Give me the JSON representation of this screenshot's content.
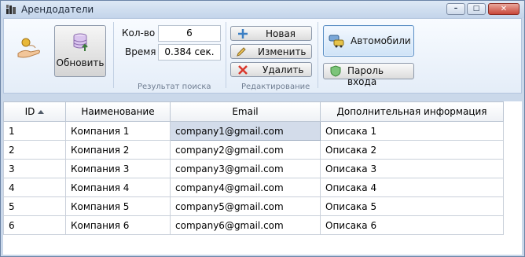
{
  "window": {
    "title": "Арендодатели",
    "controls": {
      "minimize": "–",
      "maximize": "□",
      "close": "✕"
    }
  },
  "toolbar": {
    "refresh_label": "Обновить",
    "search": {
      "count_label": "Кол-во",
      "count_value": "6",
      "time_label": "Время",
      "time_value": "0.384 сек.",
      "caption": "Результат поиска"
    },
    "edit": {
      "new_label": "Новая",
      "edit_label": "Изменить",
      "delete_label": "Удалить",
      "caption": "Редактирование"
    },
    "cars_label": "Автомобили",
    "password_label": "Пароль входа"
  },
  "table": {
    "columns": [
      "ID",
      "Наименование",
      "Email",
      "Дополнительная информация"
    ],
    "rows": [
      {
        "id": "1",
        "name": "Компания 1",
        "email": "company1@gmail.com",
        "info": "Описака 1"
      },
      {
        "id": "2",
        "name": "Компания 2",
        "email": "company2@gmail.com",
        "info": "Описака 2"
      },
      {
        "id": "3",
        "name": "Компания 3",
        "email": "company3@gmail.com",
        "info": "Описака 3"
      },
      {
        "id": "4",
        "name": "Компания 4",
        "email": "company4@gmail.com",
        "info": "Описака 4"
      },
      {
        "id": "5",
        "name": "Компания 5",
        "email": "company5@gmail.com",
        "info": "Описака 5"
      },
      {
        "id": "6",
        "name": "Компания 6",
        "email": "company6@gmail.com",
        "info": "Описака 6"
      }
    ],
    "selected_cell": "company1@gmail.com"
  },
  "icons": {
    "app": "app-icon",
    "hand": "hand-coin-icon",
    "refresh": "database-refresh-icon",
    "new": "plus-icon",
    "edit": "pencil-icon",
    "delete": "x-icon",
    "cars": "cars-icon",
    "password": "shield-icon"
  }
}
